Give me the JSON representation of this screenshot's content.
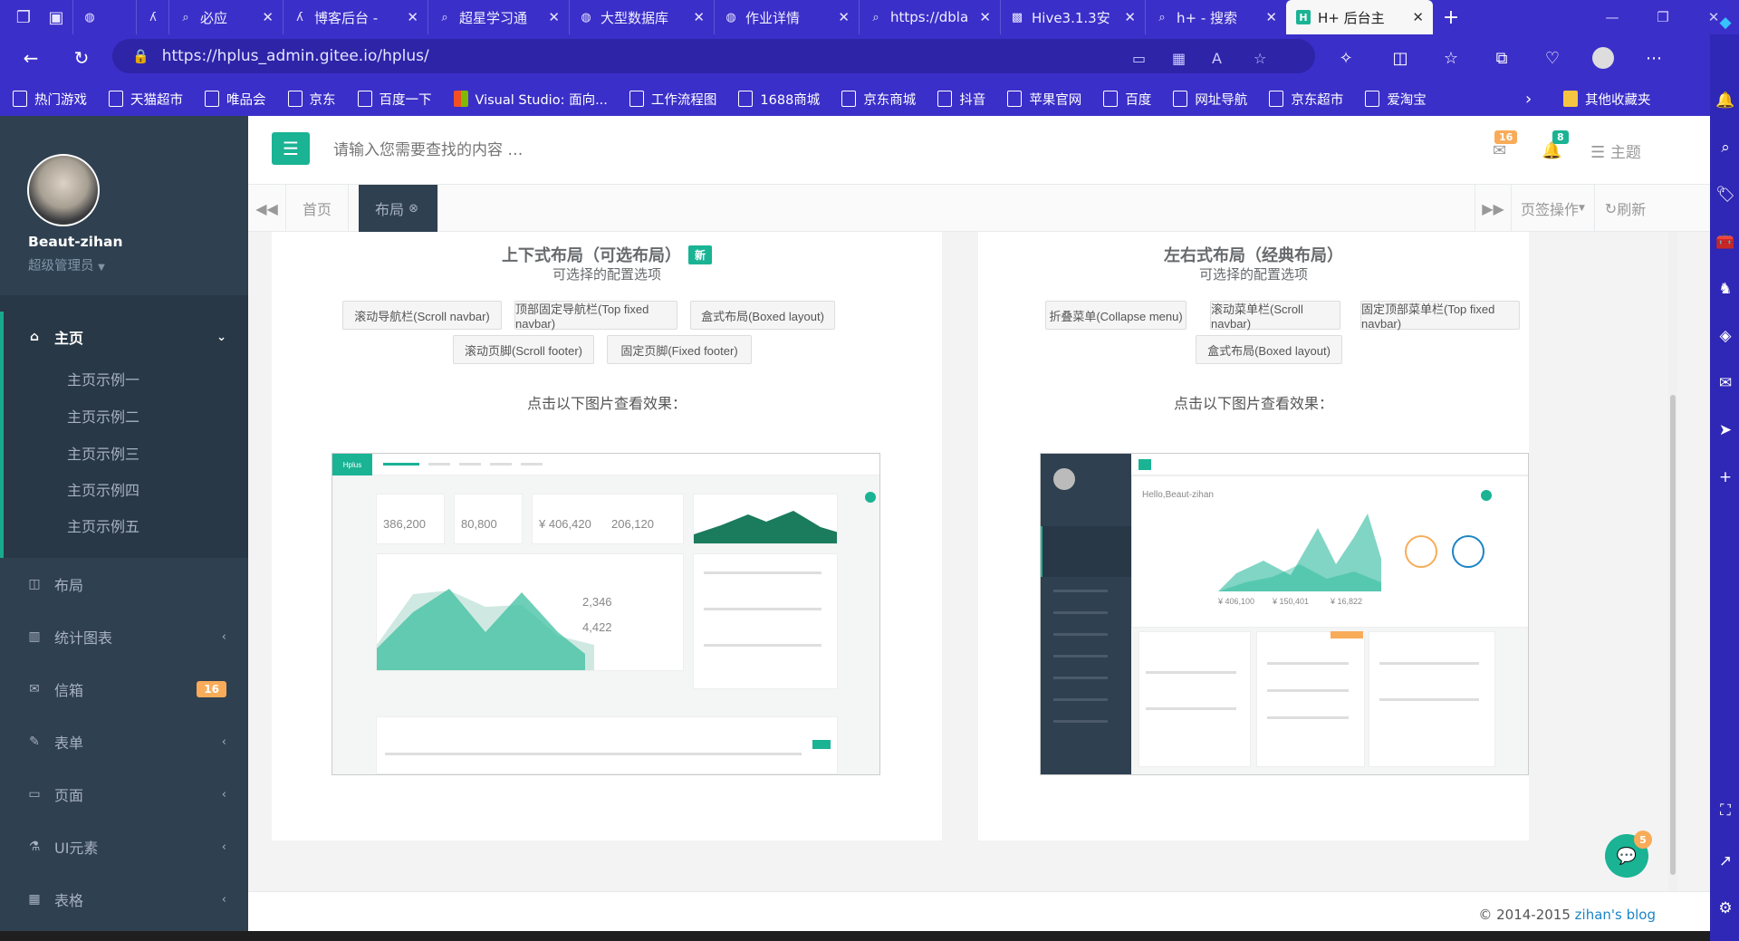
{
  "browser": {
    "tabs": [
      {
        "title": "必应",
        "icon": "search-icon"
      },
      {
        "title": "博客后台 - ",
        "icon": "blog-icon"
      },
      {
        "title": "超星学习通",
        "icon": "search-icon"
      },
      {
        "title": "大型数据库",
        "icon": "globe-icon"
      },
      {
        "title": "作业详情",
        "icon": "globe-icon"
      },
      {
        "title": "https://dbla",
        "icon": "search-icon"
      },
      {
        "title": "Hive3.1.3安",
        "icon": "hive-icon"
      },
      {
        "title": "h+ - 搜索",
        "icon": "search-icon"
      },
      {
        "title": "H+ 后台主",
        "icon": "hplus-icon"
      }
    ],
    "url": "https://hplus_admin.gitee.io/hplus/",
    "bookmarks": [
      "热门游戏",
      "天猫超市",
      "唯品会",
      "京东",
      "百度一下",
      "Visual Studio: 面向...",
      "工作流程图",
      "1688商城",
      "京东商城",
      "抖音",
      "苹果官网",
      "百度",
      "网址导航",
      "京东超市",
      "爱淘宝"
    ],
    "other_bookmarks": "其他收藏夹"
  },
  "sidebar": {
    "user_name": "Beaut-zihan",
    "user_role": "超级管理员",
    "menu": [
      {
        "label": "主页",
        "icon": "home-icon",
        "active": true
      },
      {
        "label": "布局",
        "icon": "columns-icon"
      },
      {
        "label": "统计图表",
        "icon": "bar-chart-icon"
      },
      {
        "label": "信箱",
        "icon": "envelope-icon",
        "badge": "16"
      },
      {
        "label": "表单",
        "icon": "edit-icon"
      },
      {
        "label": "页面",
        "icon": "desktop-icon"
      },
      {
        "label": "UI元素",
        "icon": "flask-icon"
      },
      {
        "label": "表格",
        "icon": "table-icon"
      }
    ],
    "submenu": [
      "主页示例一",
      "主页示例二",
      "主页示例三",
      "主页示例四",
      "主页示例五"
    ]
  },
  "topbar": {
    "search_placeholder": "请输入您需要查找的内容 …",
    "mail_count": "16",
    "bell_count": "8",
    "theme_label": "主题"
  },
  "pagetabs": {
    "tabs": [
      "首页",
      "布局"
    ],
    "actions_label": "页签操作",
    "refresh_label": "刷新"
  },
  "left_card": {
    "title": "上下式布局（可选布局）",
    "new_badge": "新",
    "subtitle": "可选择的配置选项",
    "options": [
      "滚动导航栏(Scroll navbar)",
      "顶部固定导航栏(Top fixed navbar)",
      "盒式布局(Boxed layout)",
      "滚动页脚(Scroll footer)",
      "固定页脚(Fixed footer)"
    ],
    "click_text": "点击以下图片查看效果："
  },
  "right_card": {
    "title": "左右式布局（经典布局）",
    "subtitle": "可选择的配置选项",
    "options": [
      "折叠菜单(Collapse menu)",
      "滚动菜单栏(Scroll navbar)",
      "固定顶部菜单栏(Top fixed navbar)",
      "盒式布局(Boxed layout)"
    ],
    "click_text": "点击以下图片查看效果："
  },
  "preview_left": {
    "logo": "Hplus",
    "stats": [
      "386,200",
      "80,800",
      "¥ 406,420",
      "206,120"
    ],
    "side_nums": [
      "2,346",
      "4,422"
    ]
  },
  "preview_right": {
    "greeting": "Hello,Beaut-zihan",
    "stats": [
      "¥ 406,100",
      "¥ 150,401",
      "¥ 16,822"
    ]
  },
  "footer": {
    "copyright": "© 2014-2015",
    "link": "zihan's blog"
  },
  "chat_badge": "5",
  "colors": {
    "accent": "#1ab394",
    "sidebar": "#2f4050",
    "browser": "#3b2fc9",
    "badge": "#f8ac59"
  }
}
